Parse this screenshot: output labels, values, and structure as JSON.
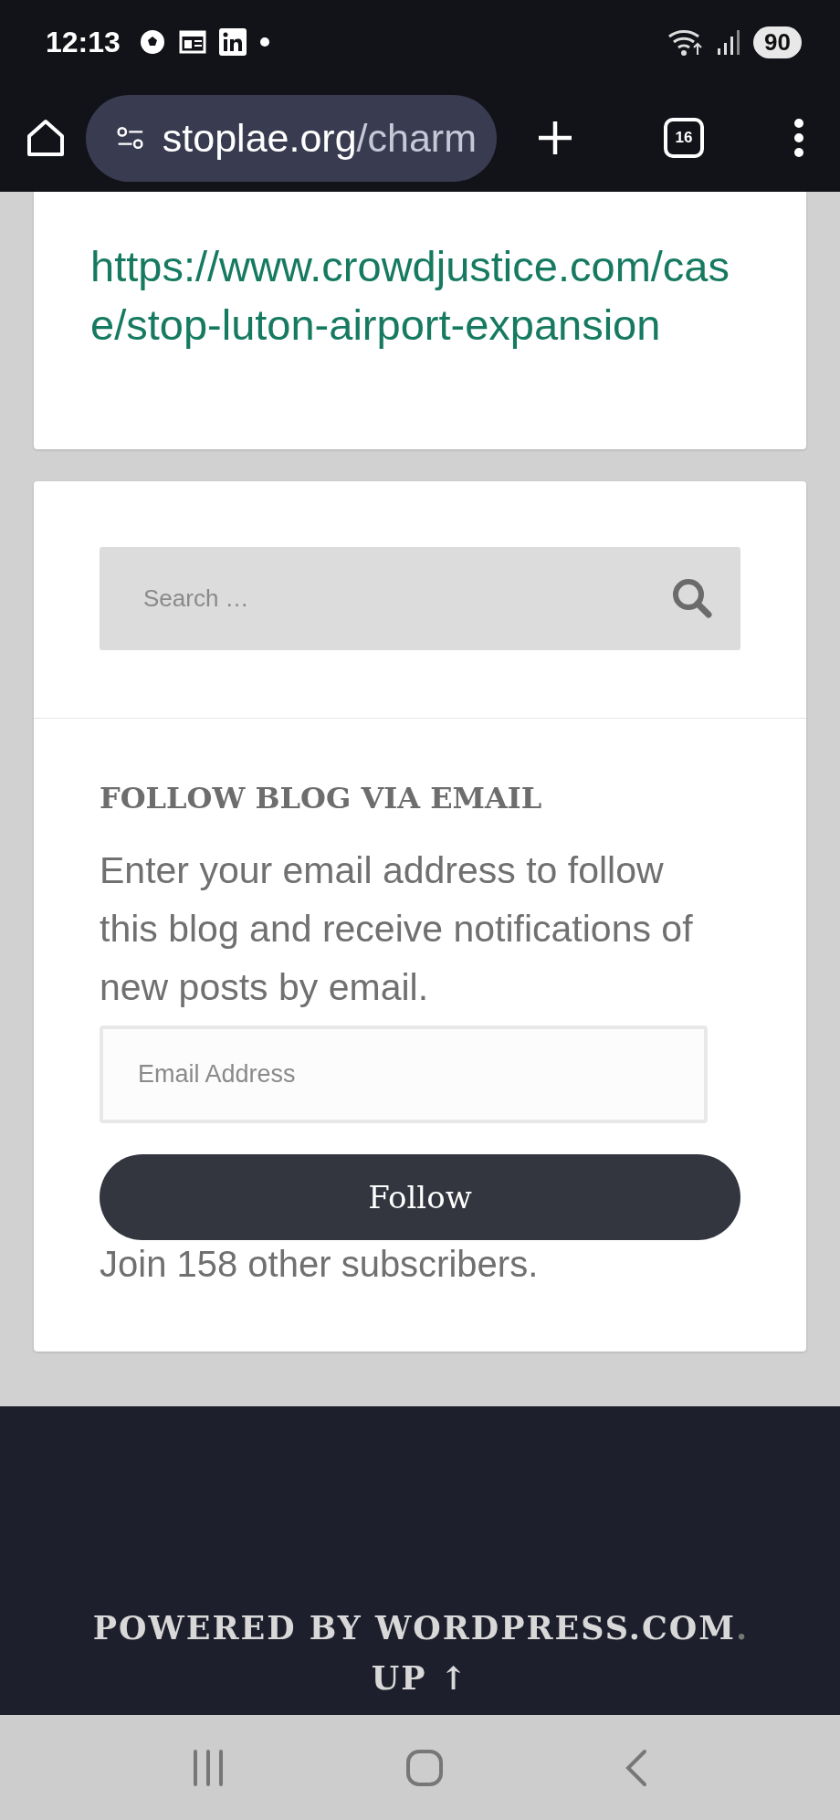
{
  "status_bar": {
    "time": "12:13",
    "battery": "90"
  },
  "browser": {
    "url_host": "stoplae.org",
    "url_path": "/charm",
    "tab_count": "16"
  },
  "link_card": {
    "link": "https://www.crowdjustice.com/case/stop-luton-airport-expansion"
  },
  "search": {
    "placeholder": "Search …"
  },
  "follow": {
    "heading": "FOLLOW BLOG VIA EMAIL",
    "text": "Enter your email address to follow this blog and receive notifications of new posts by email.",
    "email_placeholder": "Email Address",
    "button": "Follow",
    "subscribers": "Join 158 other subscribers."
  },
  "footer": {
    "powered": "POWERED BY WORDPRESS.COM",
    "dot": ".",
    "up": "UP ↑"
  }
}
